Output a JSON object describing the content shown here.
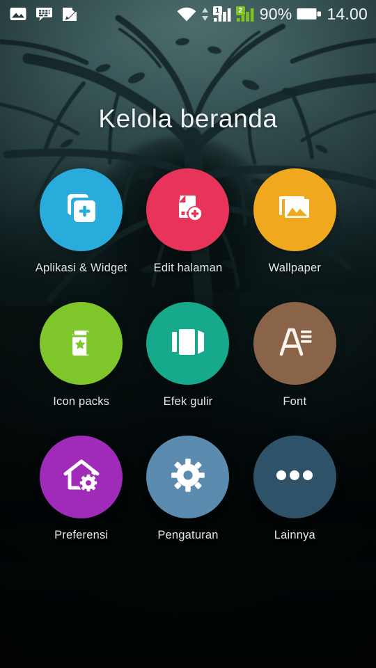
{
  "statusbar": {
    "left_icons": [
      {
        "name": "photo-notification-icon",
        "glyph": "image"
      },
      {
        "name": "bbm-message-icon",
        "glyph": "chat"
      },
      {
        "name": "note-pen-icon",
        "glyph": "note"
      }
    ],
    "wifi_icon": "wifi-icon",
    "data_transfer_icon": "data-up-down-arrows-icon",
    "sim1": {
      "name": "sim1-signal-icon",
      "badge": "1"
    },
    "sim2": {
      "name": "sim2-signal-icon",
      "badge": "2"
    },
    "battery_percent": "90%",
    "battery_icon": "battery-icon",
    "time": "14.00"
  },
  "header": {
    "title": "Kelola beranda"
  },
  "colors": {
    "apps_widgets": "#29abdb",
    "edit_page": "#e8345b",
    "wallpaper": "#f0a81e",
    "icon_packs": "#7fc62a",
    "scroll_effect": "#17a98c",
    "font": "#8a6448",
    "preferences": "#a02bb8",
    "settings": "#5b8caf",
    "more": "#2e5268",
    "title_text": "#f0f4f4",
    "label_text": "#e2e9e9"
  },
  "grid": {
    "items": [
      {
        "label": "Aplikasi & Widget",
        "icon": "add-apps-widgets-icon",
        "color_key": "apps_widgets",
        "name": "apps-widgets"
      },
      {
        "label": "Edit halaman",
        "icon": "add-page-icon",
        "color_key": "edit_page",
        "name": "edit-page"
      },
      {
        "label": "Wallpaper",
        "icon": "photos-stack-icon",
        "color_key": "wallpaper",
        "name": "wallpaper"
      },
      {
        "label": "Icon packs",
        "icon": "icon-pack-star-icon",
        "color_key": "icon_packs",
        "name": "icon-packs"
      },
      {
        "label": "Efek gulir",
        "icon": "scroll-effect-icon",
        "color_key": "scroll_effect",
        "name": "scroll-effect"
      },
      {
        "label": "Font",
        "icon": "font-a-lines-icon",
        "color_key": "font",
        "name": "font"
      },
      {
        "label": "Preferensi",
        "icon": "home-gear-icon",
        "color_key": "preferences",
        "name": "preferences"
      },
      {
        "label": "Pengaturan",
        "icon": "gear-icon",
        "color_key": "settings",
        "name": "settings"
      },
      {
        "label": "Lainnya",
        "icon": "more-dots-icon",
        "color_key": "more",
        "name": "more"
      }
    ]
  }
}
